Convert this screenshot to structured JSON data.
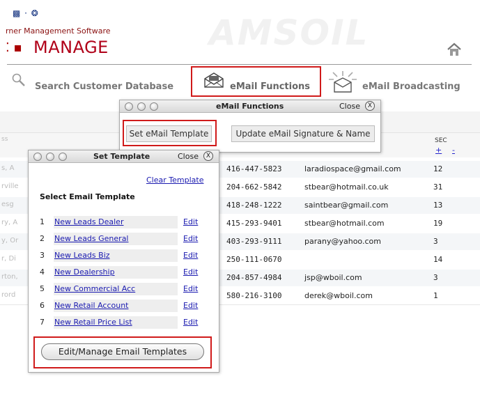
{
  "header": {
    "subtitle": "rner Management Software",
    "title": "MANAGE",
    "watermark": "AMSOIL"
  },
  "nav": {
    "search_label": "Search Customer Database",
    "email_functions_label": "eMail Functions",
    "broadcasting_label": "eMail Broadcasting"
  },
  "table": {
    "sec_header": "SEC",
    "sort_plus": "+",
    "sort_minus": "-",
    "rows": [
      {
        "name": "s, A",
        "phone": "416-447-5823",
        "email": "laradiospace@gmail.com",
        "sec": "12"
      },
      {
        "name": "rville",
        "phone": "204-662-5842",
        "email": "stbear@hotmail.co.uk",
        "sec": "31"
      },
      {
        "name": "esg",
        "phone": "418-248-1222",
        "email": "saintbear@gmail.com",
        "sec": "13"
      },
      {
        "name": "ry, A",
        "phone": "415-293-9401",
        "email": "stbear@hotmail.com",
        "sec": "19"
      },
      {
        "name": "y, Or",
        "phone": "403-293-9111",
        "email": "parany@yahoo.com",
        "sec": "3"
      },
      {
        "name": "r, Di",
        "phone": "250-111-0670",
        "email": "",
        "sec": "14"
      },
      {
        "name": "rton,",
        "phone": "204-857-4984",
        "email": "jsp@wboil.com",
        "sec": "3"
      },
      {
        "name": "rord",
        "phone": "580-216-3100",
        "email": "derek@wboil.com",
        "sec": "1"
      }
    ]
  },
  "email_functions_window": {
    "title": "eMail Functions",
    "close_label": "Close",
    "close_glyph": "X",
    "set_template_button": "Set eMail Template",
    "update_signature_button": "Update eMail Signature & Name"
  },
  "set_template_window": {
    "title": "Set Template",
    "close_label": "Close",
    "close_glyph": "X",
    "clear_link": "Clear Template",
    "select_title": "Select Email Template",
    "templates": [
      {
        "num": "1",
        "name": "New Leads Dealer",
        "edit": "Edit"
      },
      {
        "num": "2",
        "name": "New Leads General",
        "edit": "Edit"
      },
      {
        "num": "3",
        "name": "New Leads Biz",
        "edit": "Edit"
      },
      {
        "num": "4",
        "name": "New Dealership",
        "edit": "Edit"
      },
      {
        "num": "5",
        "name": "New Commercial Acc",
        "edit": "Edit"
      },
      {
        "num": "6",
        "name": "New Retail Account",
        "edit": "Edit"
      },
      {
        "num": "7",
        "name": "New Retail Price List",
        "edit": "Edit"
      }
    ],
    "manage_button": "Edit/Manage Email Templates"
  },
  "colors": {
    "accent_red": "#d01a1a",
    "title_red": "#b00018",
    "link_blue": "#1a1ab0"
  }
}
